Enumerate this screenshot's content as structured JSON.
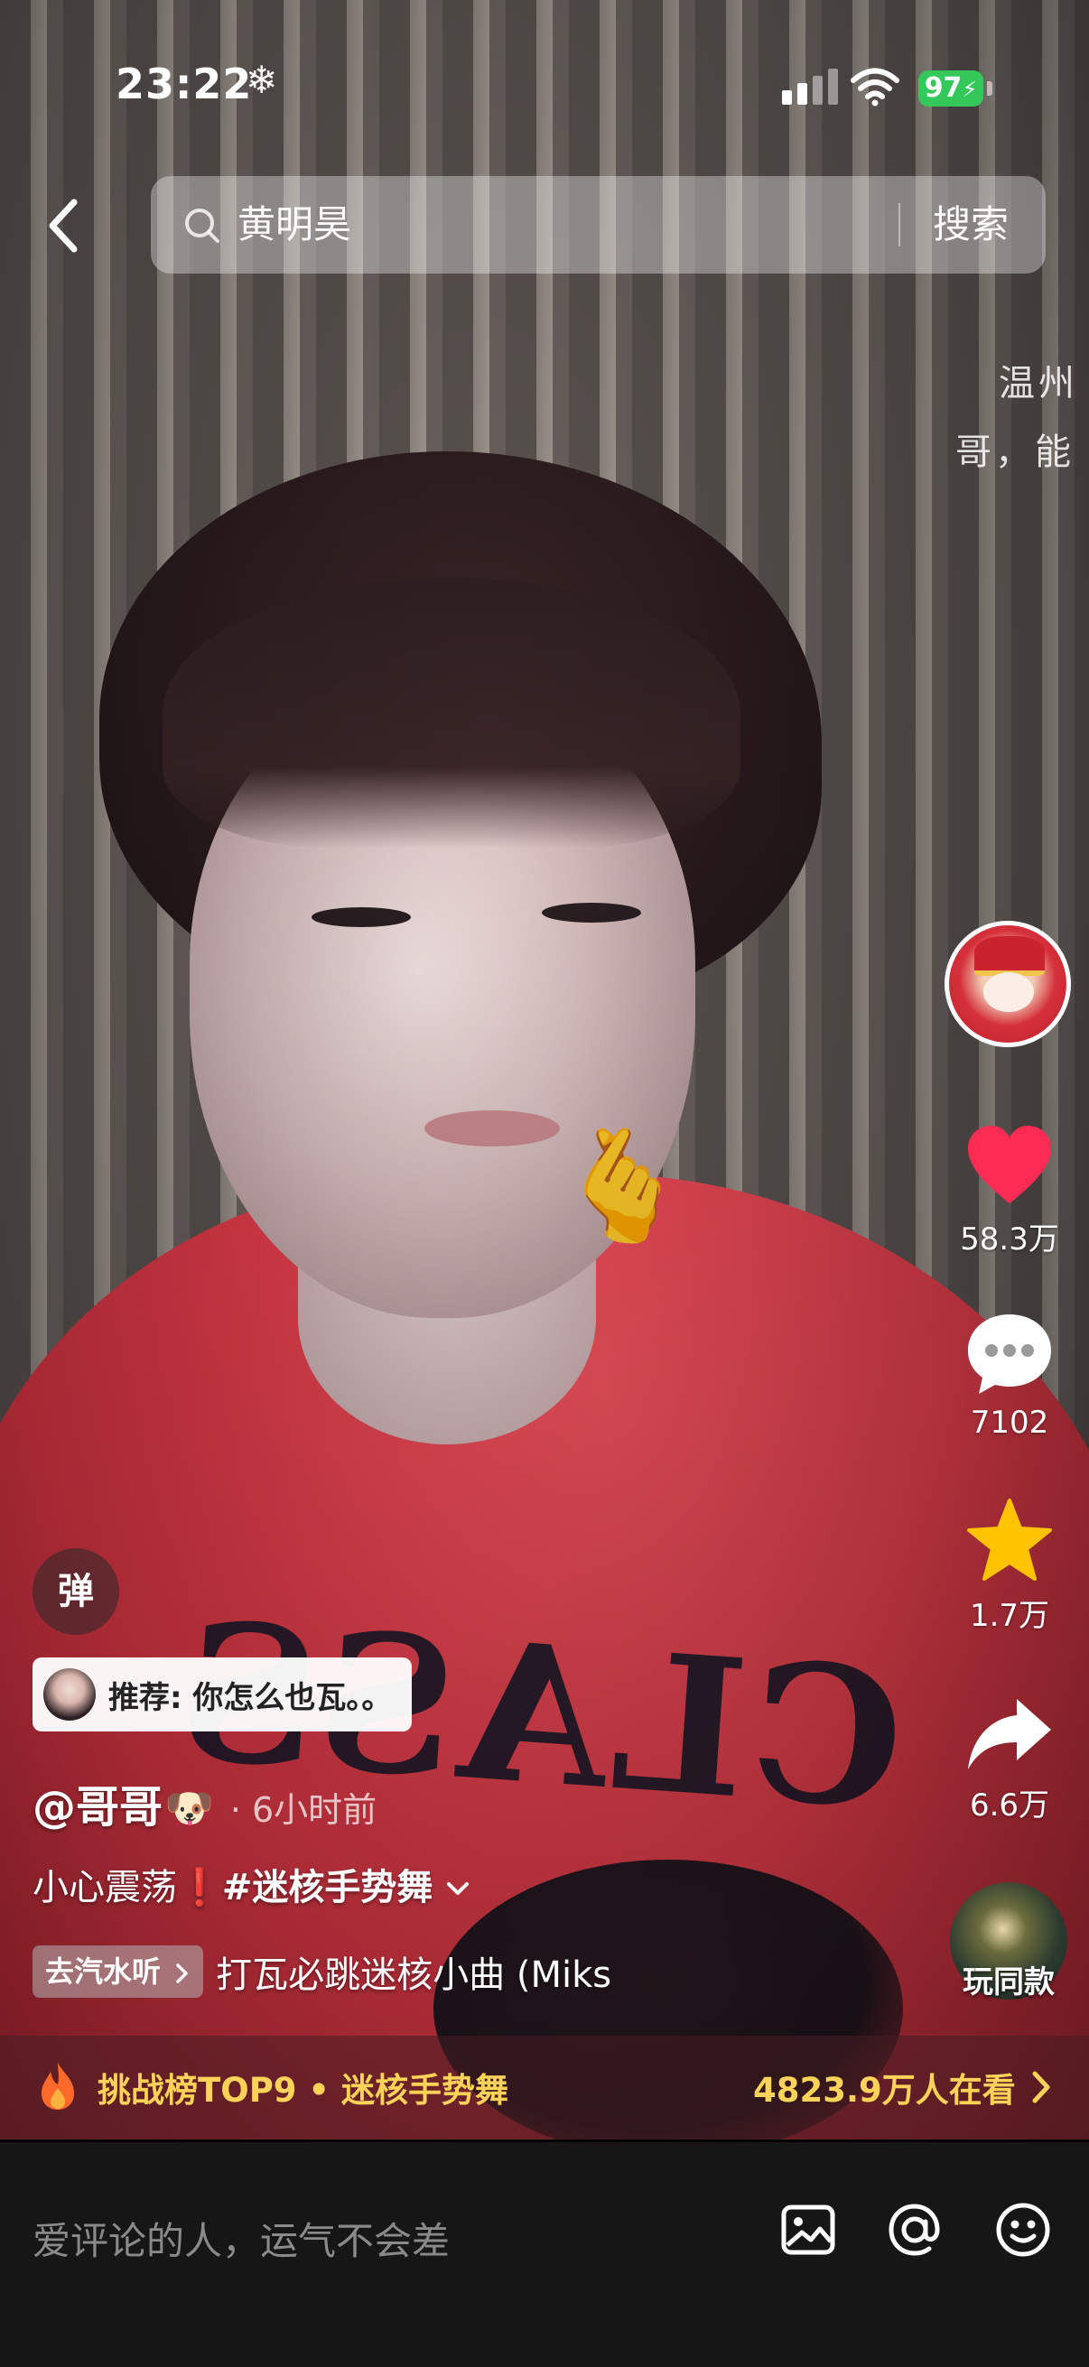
{
  "status_bar": {
    "time": "23:22",
    "extra_icon": "snowflake-icon",
    "battery": "97"
  },
  "search": {
    "query": "黄明昊",
    "button_label": "搜索"
  },
  "floating_text": {
    "line1": "温州",
    "line2": "哥，能"
  },
  "actions": {
    "likes": "58.3万",
    "comments": "7102",
    "favorites": "1.7万",
    "shares": "6.6万",
    "play_same": "玩同款"
  },
  "video_info": {
    "danmaku_label": "弹",
    "recommend": "推荐: 你怎么也瓦。。",
    "author": "@哥哥",
    "author_emoji": "🐶",
    "time": "· 6小时前",
    "caption_text": "小心震荡",
    "caption_emoji": "❗",
    "caption_hashtag": "#迷核手势舞",
    "listen_chip": "去汽水听",
    "music": "打瓦必跳迷核小曲 (Miks"
  },
  "challenge": {
    "text": "挑战榜TOP9 • 迷核手势舞",
    "viewers": "4823.9万人在看"
  },
  "comment_bar": {
    "placeholder": "爱评论的人，运气不会差"
  },
  "colors": {
    "accent_like": "#fe2c55",
    "favorite": "#ffc300",
    "challenge_text": "#ffd35a",
    "battery": "#34c759"
  }
}
